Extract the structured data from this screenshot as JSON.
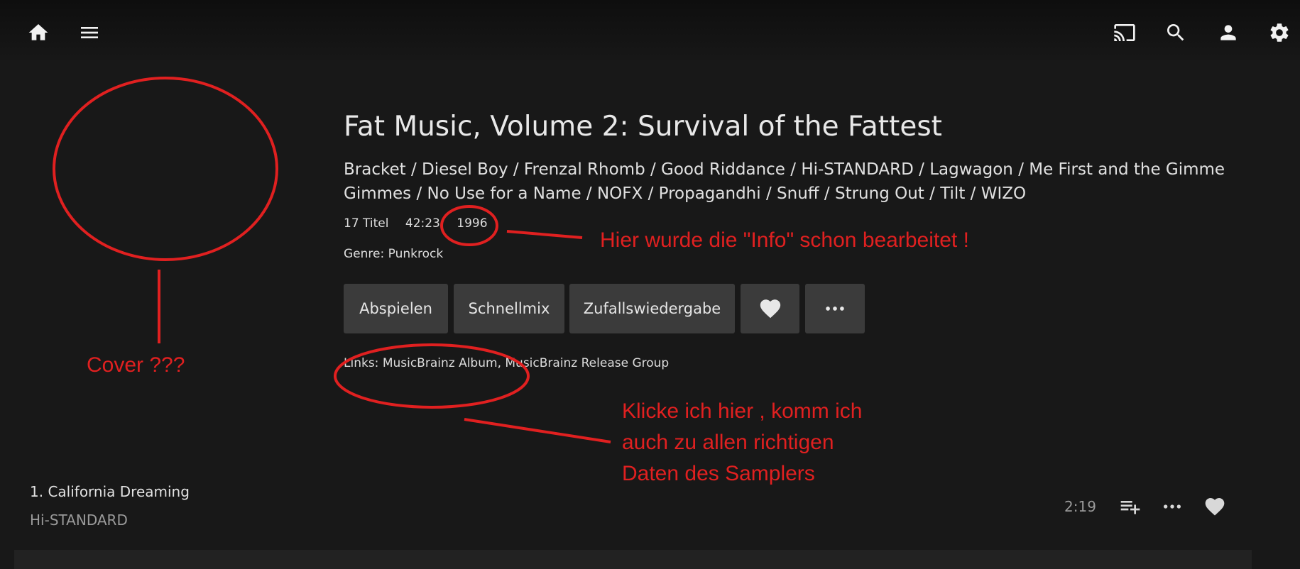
{
  "album": {
    "title": "Fat Music, Volume 2: Survival of the Fattest",
    "artists": "Bracket / Diesel Boy / Frenzal Rhomb / Good Riddance / Hi-STANDARD / Lagwagon / Me First and the Gimme Gimmes / No Use for a Name / NOFX / Propagandhi / Snuff / Strung Out / Tilt / WIZO",
    "track_count": "17 Titel",
    "duration": "42:23",
    "year": "1996",
    "genre": "Genre: Punkrock",
    "links_prefix": "Links: ",
    "link_album": "MusicBrainz Album",
    "link_separator": ", ",
    "link_release_group": "MusicBrainz Release Group"
  },
  "buttons": {
    "play": "Abspielen",
    "instant_mix": "Schnellmix",
    "shuffle": "Zufallswiedergabe"
  },
  "tracks": [
    {
      "title": "1. California Dreaming",
      "artist": "Hi-STANDARD",
      "duration": "2:19"
    }
  ],
  "annotations": {
    "cover": "Cover ???",
    "info": "Hier wurde die \"Info\" schon bearbeitet !",
    "links_line1": "Klicke ich hier , komm ich",
    "links_line2": "auch zu allen richtigen",
    "links_line3": "Daten des Samplers"
  },
  "icons": {
    "home": "home-icon",
    "menu": "menu-icon",
    "cast": "cast-icon",
    "search": "search-icon",
    "user": "user-icon",
    "settings": "gear-icon",
    "favorite": "heart-icon",
    "more": "more-icon",
    "playlist_add": "playlist-add-icon"
  },
  "colors": {
    "background": "#181818",
    "button": "#3b3b3b",
    "annotation": "#e02020"
  }
}
